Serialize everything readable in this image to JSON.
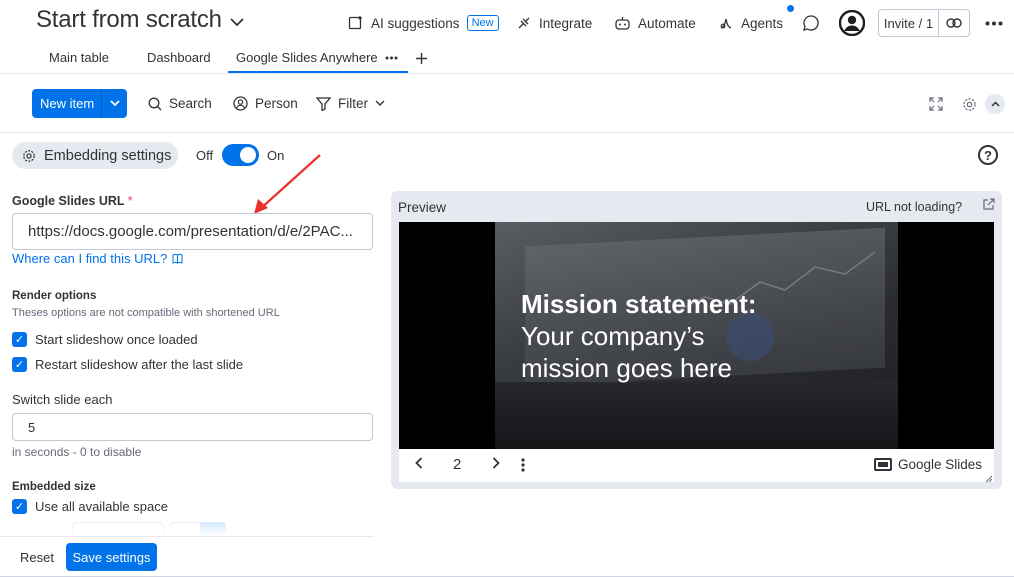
{
  "header": {
    "board_title": "Start from scratch",
    "ai_suggestions": "AI suggestions",
    "new_badge": "New",
    "integrate": "Integrate",
    "automate": "Automate",
    "agents": "Agents",
    "invite": "Invite / 1"
  },
  "tabs": [
    {
      "label": "Main table"
    },
    {
      "label": "Dashboard"
    },
    {
      "label": "Google Slides Anywhere",
      "active": true
    }
  ],
  "toolbar": {
    "new_item": "New item",
    "search": "Search",
    "person": "Person",
    "filter": "Filter"
  },
  "settings": {
    "embedding_settings": "Embedding settings",
    "off_label": "Off",
    "on_label": "On",
    "toggle_on": true,
    "google_slides_url_label": "Google Slides URL",
    "required_mark": "*",
    "url_value": "https://docs.google.com/presentation/d/e/2PAC...",
    "where_url": "Where can I find this URL?",
    "render_options_title": "Render options",
    "render_options_hint": "Theses options are not compatible with shortened URL",
    "start_slideshow": "Start slideshow once loaded",
    "restart_slideshow": "Restart slideshow after the last slide",
    "switch_slide_label": "Switch slide each",
    "switch_slide_value": "5",
    "switch_slide_hint": "in seconds - 0 to disable",
    "embedded_size_title": "Embedded size",
    "use_all_space": "Use all available space",
    "reset": "Reset",
    "save": "Save settings"
  },
  "preview": {
    "label": "Preview",
    "url_not_loading": "URL not loading?",
    "slide_line1": "Mission statement:",
    "slide_line2": "Your company’s",
    "slide_line3": "mission goes here",
    "current_slide": "2",
    "brand": "Google Slides"
  },
  "colors": {
    "accent": "#0073ea",
    "required": "#e2445c"
  }
}
